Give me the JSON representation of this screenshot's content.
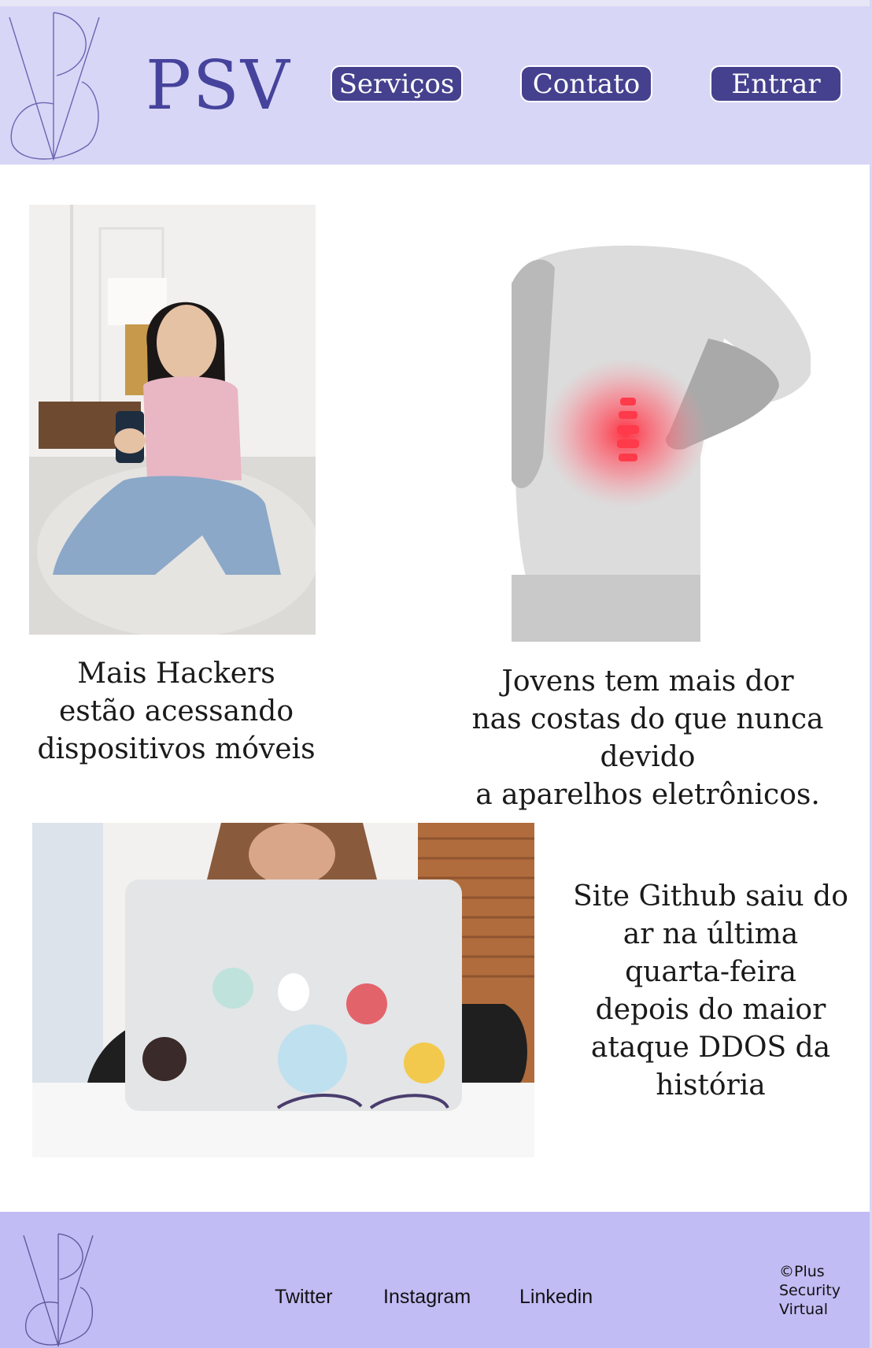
{
  "header": {
    "brand": "PSV",
    "nav": [
      {
        "label": "Serviços"
      },
      {
        "label": "Contato"
      },
      {
        "label": "Entrar"
      }
    ]
  },
  "articles": [
    {
      "text": "Mais Hackers\nestão acessando\ndispositivos móveis",
      "image": "woman-with-phone-photo"
    },
    {
      "text": "Jovens tem mais dor\nnas costas do que nunca devido\na aparelhos eletrônicos.",
      "image": "back-pain-photo"
    },
    {
      "text": "Site Github saiu do\nar na última\nquarta-feira\ndepois do maior\nataque DDOS da\nhistória",
      "image": "laptop-github-stickers-photo"
    }
  ],
  "footer": {
    "links": [
      {
        "label": "Twitter"
      },
      {
        "label": "Instagram"
      },
      {
        "label": "Linkedin"
      }
    ],
    "copyright": "©Plus\nSecurity\nVirtual"
  },
  "colors": {
    "header_bg": "#d8d6f6",
    "footer_bg": "#c1bcf4",
    "accent": "#45418e"
  }
}
